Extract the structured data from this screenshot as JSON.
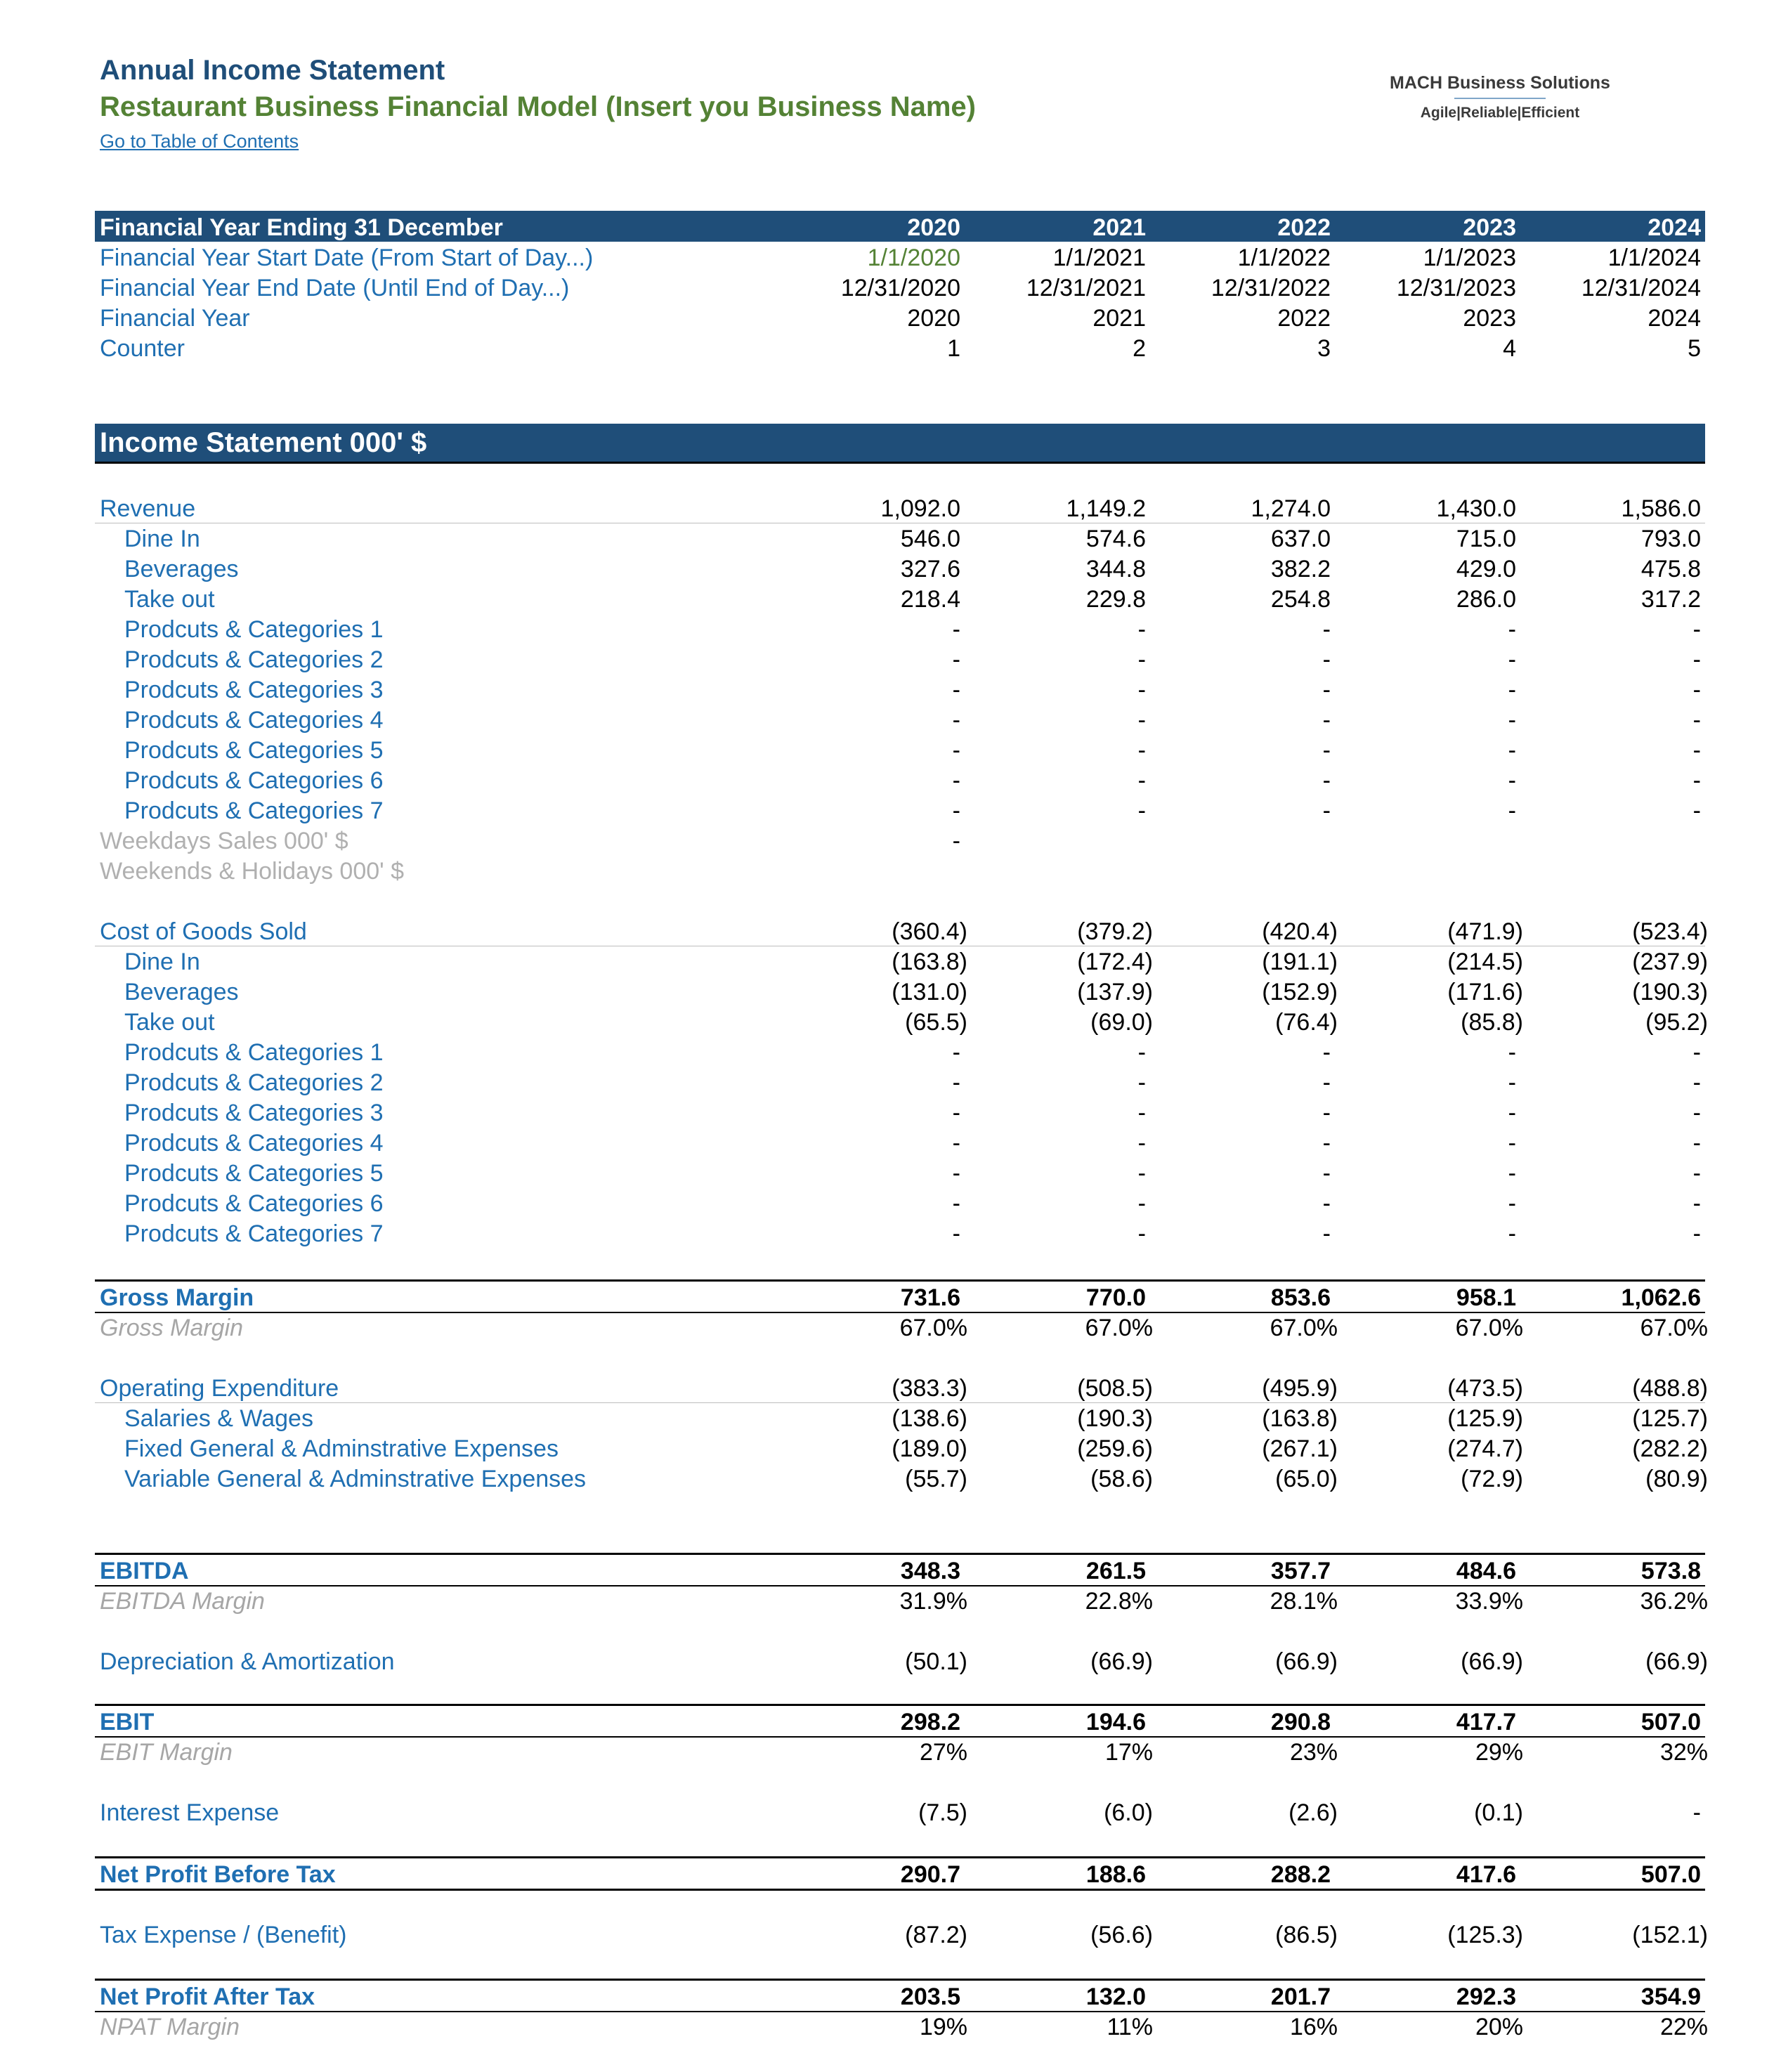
{
  "header": {
    "title": "Annual Income Statement",
    "subtitle": "Restaurant Business Financial Model (Insert you Business Name)",
    "toc_link": "Go to Table of Contents"
  },
  "logo": {
    "name": "MACH Business Solutions",
    "tagline": "Agile|Reliable|Efficient"
  },
  "colors": {
    "header_bar": "#1F4E79",
    "label_blue": "#1F6FB2",
    "subtitle_green": "#548235"
  },
  "periods": {
    "label": "Financial Year Ending 31 December",
    "years": [
      "2020",
      "2021",
      "2022",
      "2023",
      "2024"
    ],
    "rows": [
      {
        "label": "Financial Year Start Date (From Start of Day...)",
        "values": [
          "1/1/2020",
          "1/1/2021",
          "1/1/2022",
          "1/1/2023",
          "1/1/2024"
        ]
      },
      {
        "label": "Financial Year End Date (Until End of Day...)",
        "values": [
          "12/31/2020",
          "12/31/2021",
          "12/31/2022",
          "12/31/2023",
          "12/31/2024"
        ]
      },
      {
        "label": "Financial Year",
        "values": [
          "2020",
          "2021",
          "2022",
          "2023",
          "2024"
        ]
      },
      {
        "label": "Counter",
        "values": [
          "1",
          "2",
          "3",
          "4",
          "5"
        ]
      }
    ]
  },
  "income_statement": {
    "section_title": "Income Statement 000' $",
    "revenue": {
      "total": {
        "label": "Revenue",
        "values": [
          "1,092.0",
          "1,149.2",
          "1,274.0",
          "1,430.0",
          "1,586.0"
        ]
      },
      "items": [
        {
          "label": "Dine In",
          "values": [
            "546.0",
            "574.6",
            "637.0",
            "715.0",
            "793.0"
          ]
        },
        {
          "label": "Beverages",
          "values": [
            "327.6",
            "344.8",
            "382.2",
            "429.0",
            "475.8"
          ]
        },
        {
          "label": "Take out",
          "values": [
            "218.4",
            "229.8",
            "254.8",
            "286.0",
            "317.2"
          ]
        },
        {
          "label": "Prodcuts & Categories 1",
          "values": [
            "-",
            "-",
            "-",
            "-",
            "-"
          ]
        },
        {
          "label": "Prodcuts & Categories 2",
          "values": [
            "-",
            "-",
            "-",
            "-",
            "-"
          ]
        },
        {
          "label": "Prodcuts & Categories 3",
          "values": [
            "-",
            "-",
            "-",
            "-",
            "-"
          ]
        },
        {
          "label": "Prodcuts & Categories 4",
          "values": [
            "-",
            "-",
            "-",
            "-",
            "-"
          ]
        },
        {
          "label": "Prodcuts & Categories 5",
          "values": [
            "-",
            "-",
            "-",
            "-",
            "-"
          ]
        },
        {
          "label": "Prodcuts & Categories 6",
          "values": [
            "-",
            "-",
            "-",
            "-",
            "-"
          ]
        },
        {
          "label": "Prodcuts & Categories 7",
          "values": [
            "-",
            "-",
            "-",
            "-",
            "-"
          ]
        }
      ],
      "weekdays": {
        "label": "Weekdays Sales 000' $",
        "values": [
          "-",
          "",
          "",
          "",
          ""
        ]
      },
      "weekends": {
        "label": "Weekends & Holidays 000' $",
        "values": [
          "",
          "",
          "",
          "",
          ""
        ]
      }
    },
    "cogs": {
      "total": {
        "label": "Cost of Goods Sold",
        "values": [
          "(360.4)",
          "(379.2)",
          "(420.4)",
          "(471.9)",
          "(523.4)"
        ]
      },
      "items": [
        {
          "label": "Dine In",
          "values": [
            "(163.8)",
            "(172.4)",
            "(191.1)",
            "(214.5)",
            "(237.9)"
          ]
        },
        {
          "label": "Beverages",
          "values": [
            "(131.0)",
            "(137.9)",
            "(152.9)",
            "(171.6)",
            "(190.3)"
          ]
        },
        {
          "label": "Take out",
          "values": [
            "(65.5)",
            "(69.0)",
            "(76.4)",
            "(85.8)",
            "(95.2)"
          ]
        },
        {
          "label": "Prodcuts & Categories 1",
          "values": [
            "-",
            "-",
            "-",
            "-",
            "-"
          ]
        },
        {
          "label": "Prodcuts & Categories 2",
          "values": [
            "-",
            "-",
            "-",
            "-",
            "-"
          ]
        },
        {
          "label": "Prodcuts & Categories 3",
          "values": [
            "-",
            "-",
            "-",
            "-",
            "-"
          ]
        },
        {
          "label": "Prodcuts & Categories 4",
          "values": [
            "-",
            "-",
            "-",
            "-",
            "-"
          ]
        },
        {
          "label": "Prodcuts & Categories 5",
          "values": [
            "-",
            "-",
            "-",
            "-",
            "-"
          ]
        },
        {
          "label": "Prodcuts & Categories 6",
          "values": [
            "-",
            "-",
            "-",
            "-",
            "-"
          ]
        },
        {
          "label": "Prodcuts & Categories 7",
          "values": [
            "-",
            "-",
            "-",
            "-",
            "-"
          ]
        }
      ]
    },
    "gross_margin": {
      "label": "Gross Margin",
      "values": [
        "731.6",
        "770.0",
        "853.6",
        "958.1",
        "1,062.6"
      ]
    },
    "gross_margin_pct": {
      "label": "Gross Margin",
      "values": [
        "67.0%",
        "67.0%",
        "67.0%",
        "67.0%",
        "67.0%"
      ]
    },
    "opex": {
      "total": {
        "label": "Operating Expenditure",
        "values": [
          "(383.3)",
          "(508.5)",
          "(495.9)",
          "(473.5)",
          "(488.8)"
        ]
      },
      "items": [
        {
          "label": "Salaries & Wages",
          "values": [
            "(138.6)",
            "(190.3)",
            "(163.8)",
            "(125.9)",
            "(125.7)"
          ]
        },
        {
          "label": "Fixed General & Adminstrative Expenses",
          "values": [
            "(189.0)",
            "(259.6)",
            "(267.1)",
            "(274.7)",
            "(282.2)"
          ]
        },
        {
          "label": "Variable General & Adminstrative Expenses",
          "values": [
            "(55.7)",
            "(58.6)",
            "(65.0)",
            "(72.9)",
            "(80.9)"
          ]
        }
      ]
    },
    "ebitda": {
      "label": "EBITDA",
      "values": [
        "348.3",
        "261.5",
        "357.7",
        "484.6",
        "573.8"
      ]
    },
    "ebitda_margin": {
      "label": "EBITDA Margin",
      "values": [
        "31.9%",
        "22.8%",
        "28.1%",
        "33.9%",
        "36.2%"
      ]
    },
    "da": {
      "label": "Depreciation & Amortization",
      "values": [
        "(50.1)",
        "(66.9)",
        "(66.9)",
        "(66.9)",
        "(66.9)"
      ]
    },
    "ebit": {
      "label": "EBIT",
      "values": [
        "298.2",
        "194.6",
        "290.8",
        "417.7",
        "507.0"
      ]
    },
    "ebit_margin": {
      "label": "EBIT Margin",
      "values": [
        "27%",
        "17%",
        "23%",
        "29%",
        "32%"
      ]
    },
    "interest": {
      "label": "Interest Expense",
      "values": [
        "(7.5)",
        "(6.0)",
        "(2.6)",
        "(0.1)",
        "-"
      ]
    },
    "npbt": {
      "label": "Net Profit Before Tax",
      "values": [
        "290.7",
        "188.6",
        "288.2",
        "417.6",
        "507.0"
      ]
    },
    "tax": {
      "label": "Tax Expense / (Benefit)",
      "values": [
        "(87.2)",
        "(56.6)",
        "(86.5)",
        "(125.3)",
        "(152.1)"
      ]
    },
    "npat": {
      "label": "Net Profit After Tax",
      "values": [
        "203.5",
        "132.0",
        "201.7",
        "292.3",
        "354.9"
      ]
    },
    "npat_margin": {
      "label": "NPAT Margin",
      "values": [
        "19%",
        "11%",
        "16%",
        "20%",
        "22%"
      ]
    }
  }
}
